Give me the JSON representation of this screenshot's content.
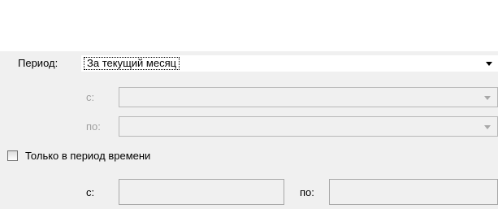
{
  "period": {
    "label": "Период:",
    "selected_value": "За текущий месяц"
  },
  "date_range": {
    "from_label": "с:",
    "to_label": "по:",
    "from_value": "",
    "to_value": ""
  },
  "time_filter": {
    "checkbox_label": "Только в период времени",
    "checked": false,
    "from_label": "с:",
    "to_label": "по:",
    "from_value": "",
    "to_value": ""
  },
  "icons": {
    "dropdown": "chevron-down-icon"
  },
  "colors": {
    "panel_background": "#f0f0f0",
    "disabled_text": "#a0a0a0"
  }
}
